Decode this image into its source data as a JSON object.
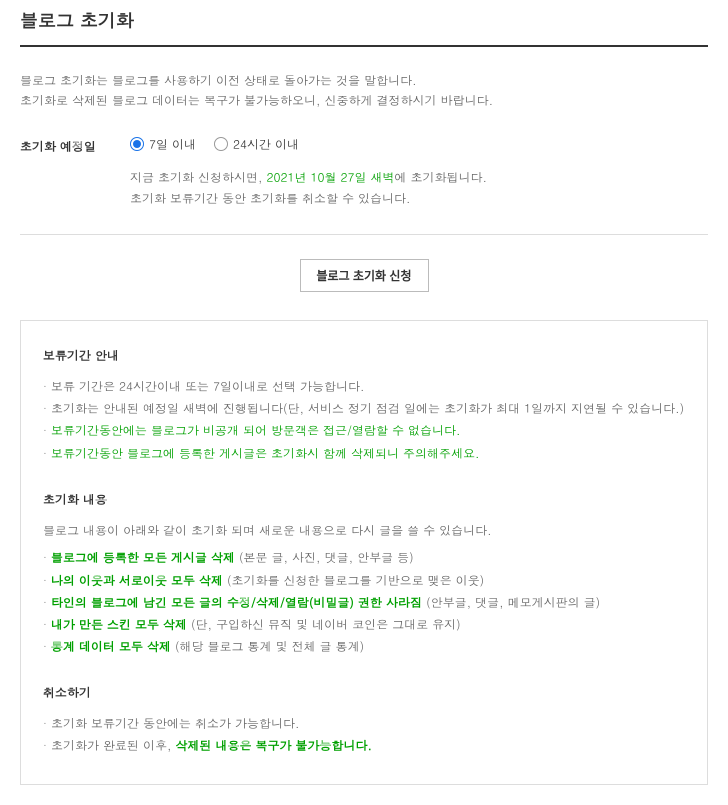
{
  "page_title": "블로그 초기화",
  "intro": {
    "line1": "블로그 초기화는 블로그를 사용하기 이전 상태로 돌아가는 것을 말합니다.",
    "line2": "초기화로 삭제된 블로그 데이터는 복구가 불가능하오니, 신중하게 결정하시기 바랍니다."
  },
  "schedule": {
    "label": "초기화 예정일",
    "option1": "7일 이내",
    "option2": "24시간 이내",
    "notice_prefix": "지금 초기화 신청하시면, ",
    "notice_date": "2021년 10월 27일 새벽",
    "notice_suffix": "에 초기화됩니다.",
    "notice_line2": "초기화 보류기간 동안 초기화를 취소할 수 있습니다."
  },
  "action_button": "블로그 초기화 신청",
  "sections": {
    "hold": {
      "title": "보류기간 안내",
      "items": [
        {
          "text": "보류 기간은 24시간이내 또는 7일이내로 선택 가능합니다.",
          "green": false
        },
        {
          "text": "초기화는 안내된 예정일 새벽에 진행됩니다(단, 서비스 정기 점검 일에는 초기화가 최대 1일까지 지연될 수 있습니다.)",
          "green": false
        },
        {
          "text": "보류기간동안에는 블로그가 비공개 되어 방문객은 접근/열람할 수 없습니다.",
          "green": true
        },
        {
          "text": "보류기간동안 블로그에 등록한 게시글은 초기화시 함께 삭제되니 주의해주세요.",
          "green": true
        }
      ]
    },
    "content": {
      "title": "초기화 내용",
      "desc": "블로그 내용이 아래와 같이 초기화 되며 새로운 내용으로 다시 글을 쓸 수 있습니다.",
      "items": [
        {
          "bold": "블로그에 등록한 모든 게시글 삭제",
          "suffix": " (본문 글, 사진, 댓글, 안부글 등)"
        },
        {
          "bold": "나의 이웃과 서로이웃 모두 삭제",
          "suffix": " (초기화를 신청한 블로그를 기반으로 맺은 이웃)"
        },
        {
          "bold": "타인의 블로그에 남긴 모든 글의 수정/삭제/열람(비밀글) 권한 사라짐",
          "suffix": " (안부글, 댓글, 메모게시판의 글)"
        },
        {
          "bold": "내가 만든 스킨 모두 삭제",
          "suffix": " (단, 구입하신 뮤직 및 네이버 코인은 그대로 유지)"
        },
        {
          "bold": "통계 데이터 모두 삭제",
          "suffix": " (해당 블로그 통계 및 전체 글 통계)"
        }
      ]
    },
    "cancel": {
      "title": "취소하기",
      "item1": "초기화 보류기간 동안에는 취소가 가능합니다.",
      "item2_prefix": "초기화가 완료된 이후, ",
      "item2_bold": "삭제된 내용은 복구가 불가능합니다."
    }
  }
}
